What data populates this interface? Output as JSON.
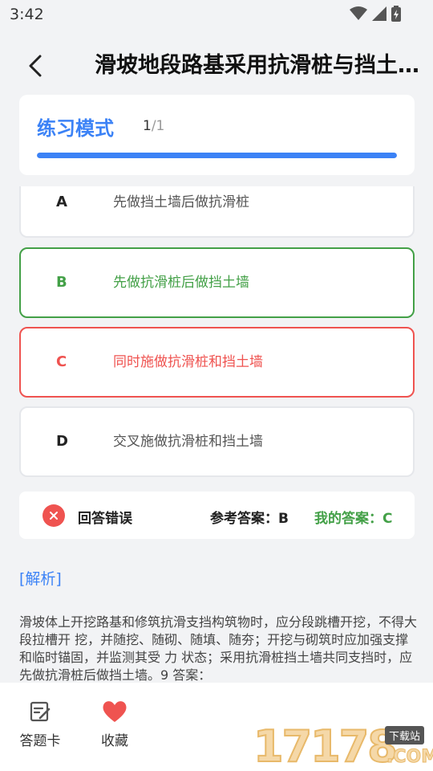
{
  "status": {
    "time": "3:42"
  },
  "header": {
    "title": "滑坡地段路基采用抗滑桩与挡土墙共同支挡时，其施工顺序应为（　）"
  },
  "mode": {
    "title": "练习模式",
    "current": "1",
    "total": "/1",
    "progress_fraction": 1.0
  },
  "options": [
    {
      "letter": "A",
      "text": "先做挡土墙后做抗滑桩",
      "state": "normal"
    },
    {
      "letter": "B",
      "text": "先做抗滑桩后做挡土墙",
      "state": "correct"
    },
    {
      "letter": "C",
      "text": "同时施做抗滑桩和挡土墙",
      "state": "wrong"
    },
    {
      "letter": "D",
      "text": "交叉施做抗滑桩和挡土墙",
      "state": "normal"
    }
  ],
  "result": {
    "label": "回答错误",
    "reference": "参考答案：B",
    "mine": "我的答案：C"
  },
  "analysis": {
    "title": "[解析]",
    "text": "滑坡体上开挖路基和修筑抗滑支挡构筑物时，应分段跳槽开挖，不得大段拉槽开 挖，并随挖、随砌、随填、随夯；开挖与砌筑时应加强支撑和临时锚固，并监测其受 力 状态；采用抗滑桩挡土墙共同支挡时，应先做抗滑桩后做挡土墙。9 答案："
  },
  "bottom": {
    "card_label": "答题卡",
    "favorite_label": "收藏"
  },
  "watermark": {
    "digits": "17178",
    "badge": "下载站",
    "com": ".COM"
  },
  "colors": {
    "accent": "#3b82f6",
    "correct": "#43a047",
    "wrong": "#ef5350",
    "favorite": "#ef5350"
  }
}
